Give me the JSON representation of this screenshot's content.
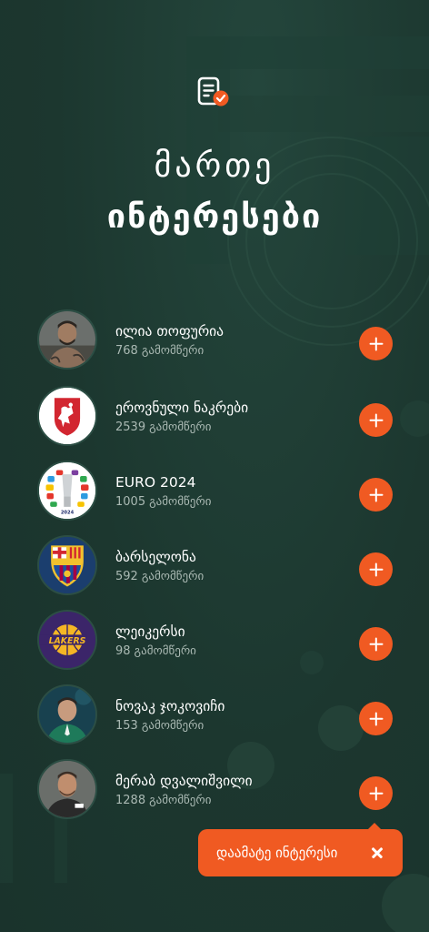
{
  "header": {
    "icon": "document-check-icon",
    "title_line1": "მართე",
    "title_line2": "ინტერესები"
  },
  "subscribers_suffix": "გამომწერი",
  "interests": [
    {
      "name": "ილია თოფურია",
      "subscribers": "768",
      "avatar": "fighter-avatar"
    },
    {
      "name": "ეროვნული ნაკრები",
      "subscribers": "2539",
      "avatar": "georgia-national-team-logo"
    },
    {
      "name": "EURO 2024",
      "subscribers": "1005",
      "avatar": "euro-2024-trophy-logo"
    },
    {
      "name": "ბარსელონა",
      "subscribers": "592",
      "avatar": "fc-barcelona-crest"
    },
    {
      "name": "ლეიკერსი",
      "subscribers": "98",
      "avatar": "la-lakers-logo"
    },
    {
      "name": "ნოვაკ ჯოკოვიჩი",
      "subscribers": "153",
      "avatar": "tennis-player-avatar"
    },
    {
      "name": "მერაბ დვალიშვილი",
      "subscribers": "1288",
      "avatar": "ufc-fighter-avatar"
    }
  ],
  "tooltip": {
    "text": "დაამატე ინტერესი",
    "close_icon": "close-icon"
  },
  "colors": {
    "background": "#1d3a32",
    "accent": "#f05a22",
    "text_secondary": "#aab9b3"
  }
}
